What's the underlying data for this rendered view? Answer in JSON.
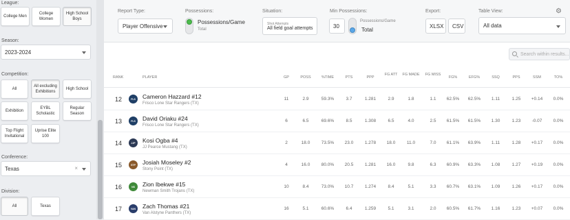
{
  "sidebar": {
    "league_label": "League:",
    "league_tiles": [
      "College Men",
      "College Women",
      "High School Boys"
    ],
    "season_label": "Season:",
    "season_value": "2023-2024",
    "competition_label": "Competition:",
    "competition_tiles": [
      "All",
      "All excluding Exhibitions",
      "High School",
      "Exhibition",
      "EYBL Scholastic",
      "Regular Season",
      "Top Flight Invitational",
      "Uprise Elite 100"
    ],
    "conference_label": "Conference:",
    "conference_value": "Texas",
    "conference_clear": "×",
    "division_label": "Division:",
    "division_tiles": [
      "All",
      "Texas"
    ]
  },
  "controls": {
    "report_type_label": "Report Type:",
    "report_type_value": "Player Offensive",
    "possessions_label": "Possessions:",
    "possessions_option": "Possessions/Game",
    "possessions_sub": "Total",
    "situation_label": "Situation:",
    "situation_small": "Shot Attempts",
    "situation_value": "All field goal attempts",
    "min_poss_label": "Min Possessions:",
    "min_poss_value": "30",
    "min_poss_option": "Possessions/Game",
    "min_poss_sub": "Total",
    "export_label": "Export:",
    "export_xlsx": "XLSX",
    "export_csv": "CSV",
    "table_view_label": "Table View:",
    "table_view_value": "All data",
    "settings_icon": "gear-icon",
    "toggle_green": "#4cbb4c",
    "toggle_blue": "#5aa7e8"
  },
  "table": {
    "search_placeholder": "Search within results...",
    "headers": [
      "RANK",
      "PLAYER",
      "GP",
      "POSS",
      "%TIME",
      "PTS",
      "PPP",
      "FG ATT",
      "FG MADE",
      "FG MISS",
      "FG%",
      "EFG%",
      "SSQ",
      "PPS",
      "SSM",
      "TO%"
    ],
    "rows": [
      {
        "rank": "12",
        "logo": "FLS",
        "logo_color": "#1f3f66",
        "name": "Cameron Hazzard",
        "num": "#12",
        "team": "Frisco Lone Star Rangers (TX)",
        "vals": [
          "11",
          "2.9",
          "59.3%",
          "3.7",
          "1.281",
          "2.9",
          "1.8",
          "1.1",
          "62.5%",
          "62.5%",
          "1.11",
          "1.25",
          "+0.14",
          "0.0%"
        ]
      },
      {
        "rank": "13",
        "logo": "FLS",
        "logo_color": "#1f3f66",
        "name": "David Oriaku",
        "num": "#24",
        "team": "Frisco Lone Star Rangers (TX)",
        "vals": [
          "6",
          "6.5",
          "69.6%",
          "8.5",
          "1.308",
          "6.5",
          "4.0",
          "2.5",
          "61.5%",
          "61.5%",
          "1.30",
          "1.23",
          "-0.07",
          "0.0%"
        ]
      },
      {
        "rank": "14",
        "logo": "JJP",
        "logo_color": "#2c3a55",
        "name": "Kosi Ogba",
        "num": "#4",
        "team": "JJ Pearce Mustang (TX)",
        "vals": [
          "2",
          "18.0",
          "73.5%",
          "23.0",
          "1.278",
          "18.0",
          "11.0",
          "7.0",
          "61.1%",
          "63.9%",
          "1.11",
          "1.28",
          "+0.17",
          "0.0%"
        ]
      },
      {
        "rank": "15",
        "logo": "STP",
        "logo_color": "#8a5a2b",
        "name": "Josiah Moseley",
        "num": "#2",
        "team": "Stony Point (TX)",
        "vals": [
          "4",
          "16.0",
          "80.0%",
          "20.5",
          "1.281",
          "16.0",
          "9.8",
          "6.3",
          "60.9%",
          "63.3%",
          "1.08",
          "1.27",
          "+0.19",
          "0.0%"
        ]
      },
      {
        "rank": "16",
        "logo": "NS",
        "logo_color": "#3f8a3a",
        "name": "Zion Ibekwe",
        "num": "#15",
        "team": "Newman Smith Trojans (TX)",
        "vals": [
          "10",
          "8.4",
          "73.0%",
          "10.7",
          "1.274",
          "8.4",
          "5.1",
          "3.3",
          "60.7%",
          "63.1%",
          "1.09",
          "1.26",
          "+0.17",
          "0.0%"
        ]
      },
      {
        "rank": "17",
        "logo": "VAN",
        "logo_color": "#2a3d6b",
        "name": "Zach Thomas",
        "num": "#21",
        "team": "Van Alstyne Panthers (TX)",
        "vals": [
          "16",
          "5.1",
          "60.6%",
          "6.4",
          "1.259",
          "5.1",
          "3.1",
          "2.0",
          "60.5%",
          "61.7%",
          "1.16",
          "1.23",
          "+0.07",
          "0.0%"
        ]
      }
    ]
  }
}
